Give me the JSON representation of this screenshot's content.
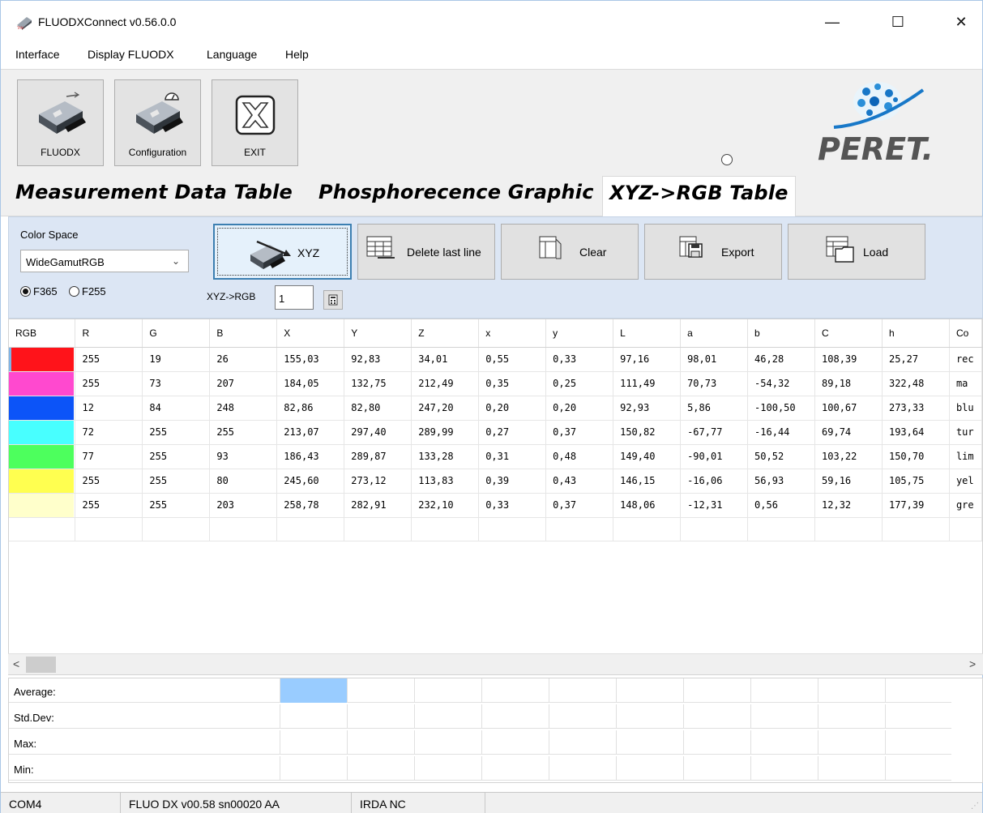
{
  "window": {
    "title": "FLUODXConnect v0.56.0.0",
    "minimize": "—",
    "maximize": "☐",
    "close": "✕"
  },
  "menu": [
    "Interface",
    "Display FLUODX",
    "Language",
    "Help"
  ],
  "toolbar": {
    "fluodx_label": "FLUODX",
    "config_label": "Configuration",
    "exit_label": "EXIT",
    "logo_text": "PERET."
  },
  "tabs": [
    {
      "label": "Measurement Data Table",
      "active": false
    },
    {
      "label": "Phosphorecence Graphic",
      "active": false
    },
    {
      "label": "XYZ->RGB Table",
      "active": true
    }
  ],
  "panel": {
    "color_space_label": "Color Space",
    "color_space_value": "WideGamutRGB",
    "radio_f365": "F365",
    "radio_f255": "F255",
    "selected_radio": "F365",
    "xyz_button": "XYZ",
    "delete_button": "Delete last line",
    "clear_button": "Clear",
    "export_button": "Export",
    "load_button": "Load",
    "xyz_rgb_label": "XYZ->RGB",
    "xyz_rgb_value": "1"
  },
  "table": {
    "headers": [
      "RGB",
      "R",
      "G",
      "B",
      "X",
      "Y",
      "Z",
      "x",
      "y",
      "L",
      "a",
      "b",
      "C",
      "h",
      "Co"
    ],
    "rows": [
      {
        "swatch": "#ff131a",
        "R": "255",
        "G": "19",
        "B": "26",
        "X": "155,03",
        "Y": "92,83",
        "Z": "34,01",
        "x": "0,55",
        "y": "0,33",
        "L": "97,16",
        "a": "98,01",
        "b": "46,28",
        "C": "108,39",
        "h": "25,27",
        "Co": "rec"
      },
      {
        "swatch": "#ff49cf",
        "R": "255",
        "G": "73",
        "B": "207",
        "X": "184,05",
        "Y": "132,75",
        "Z": "212,49",
        "x": "0,35",
        "y": "0,25",
        "L": "111,49",
        "a": "70,73",
        "b": "-54,32",
        "C": "89,18",
        "h": "322,48",
        "Co": "ma"
      },
      {
        "swatch": "#0c54f8",
        "R": "12",
        "G": "84",
        "B": "248",
        "X": "82,86",
        "Y": "82,80",
        "Z": "247,20",
        "x": "0,20",
        "y": "0,20",
        "L": "92,93",
        "a": "5,86",
        "b": "-100,50",
        "C": "100,67",
        "h": "273,33",
        "Co": "blu"
      },
      {
        "swatch": "#48ffff",
        "R": "72",
        "G": "255",
        "B": "255",
        "X": "213,07",
        "Y": "297,40",
        "Z": "289,99",
        "x": "0,27",
        "y": "0,37",
        "L": "150,82",
        "a": "-67,77",
        "b": "-16,44",
        "C": "69,74",
        "h": "193,64",
        "Co": "tur"
      },
      {
        "swatch": "#4dff5d",
        "R": "77",
        "G": "255",
        "B": "93",
        "X": "186,43",
        "Y": "289,87",
        "Z": "133,28",
        "x": "0,31",
        "y": "0,48",
        "L": "149,40",
        "a": "-90,01",
        "b": "50,52",
        "C": "103,22",
        "h": "150,70",
        "Co": "lim"
      },
      {
        "swatch": "#ffff50",
        "R": "255",
        "G": "255",
        "B": "80",
        "X": "245,60",
        "Y": "273,12",
        "Z": "113,83",
        "x": "0,39",
        "y": "0,43",
        "L": "146,15",
        "a": "-16,06",
        "b": "56,93",
        "C": "59,16",
        "h": "105,75",
        "Co": "yel"
      },
      {
        "swatch": "#ffffcb",
        "R": "255",
        "G": "255",
        "B": "203",
        "X": "258,78",
        "Y": "282,91",
        "Z": "232,10",
        "x": "0,33",
        "y": "0,37",
        "L": "148,06",
        "a": "-12,31",
        "b": "0,56",
        "C": "12,32",
        "h": "177,39",
        "Co": "gre"
      }
    ]
  },
  "scroll": {
    "left": "<",
    "right": ">"
  },
  "stats": [
    "Average:",
    "Std.Dev:",
    "Max:",
    "Min:"
  ],
  "status": {
    "port": "COM4",
    "device": "FLUO DX v00.58 sn00020 AA",
    "irda": "IRDA NC"
  },
  "colors": {
    "panel_bg": "#dce6f4",
    "selected_stat_cell": "#99ccff",
    "active_button_border": "#3c7fb1"
  }
}
